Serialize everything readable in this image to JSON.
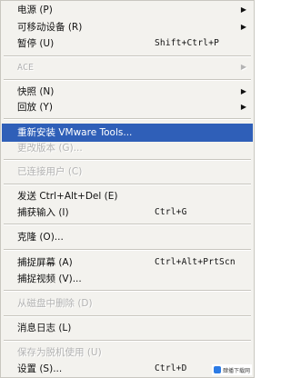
{
  "menu": {
    "items": [
      {
        "label": "电源 (P)",
        "shortcut": "",
        "arrow": "▶"
      },
      {
        "label": "可移动设备 (R)",
        "shortcut": "",
        "arrow": "▶"
      },
      {
        "label": "暂停 (U)",
        "shortcut": "Shift+Ctrl+P",
        "arrow": ""
      },
      {
        "label": "ACE",
        "shortcut": "",
        "arrow": "▶"
      },
      {
        "label": "快照 (N)",
        "shortcut": "",
        "arrow": "▶"
      },
      {
        "label": "回放 (Y)",
        "shortcut": "",
        "arrow": "▶"
      },
      {
        "label": "重新安装 VMware Tools...",
        "shortcut": "",
        "arrow": ""
      },
      {
        "label": "更改版本 (G)...",
        "shortcut": "",
        "arrow": ""
      },
      {
        "label": "已连接用户 (C)",
        "shortcut": "",
        "arrow": ""
      },
      {
        "label": "发送 Ctrl+Alt+Del (E)",
        "shortcut": "",
        "arrow": ""
      },
      {
        "label": "捕获输入 (I)",
        "shortcut": "Ctrl+G",
        "arrow": ""
      },
      {
        "label": "克隆 (O)...",
        "shortcut": "",
        "arrow": ""
      },
      {
        "label": "捕捉屏幕 (A)",
        "shortcut": "Ctrl+Alt+PrtScn",
        "arrow": ""
      },
      {
        "label": "捕捉视频 (V)...",
        "shortcut": "",
        "arrow": ""
      },
      {
        "label": "从磁盘中删除 (D)",
        "shortcut": "",
        "arrow": ""
      },
      {
        "label": "消息日志 (L)",
        "shortcut": "",
        "arrow": ""
      },
      {
        "label": "保存为脱机使用 (U)",
        "shortcut": "",
        "arrow": ""
      },
      {
        "label": "设置 (S)...",
        "shortcut": "Ctrl+D",
        "arrow": ""
      }
    ]
  },
  "watermark": {
    "text": "肆播下载网"
  },
  "colors": {
    "highlight": "#2f5fb8",
    "disabled": "#b3b3b3",
    "background": "#f3f2ee"
  }
}
